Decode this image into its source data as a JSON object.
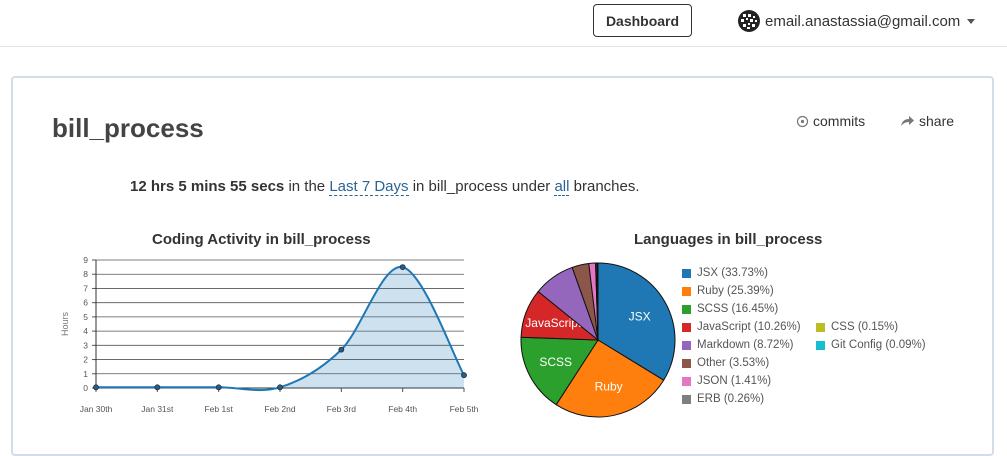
{
  "header": {
    "dashboard_label": "Dashboard",
    "user_email": "email.anastassia@gmail.com"
  },
  "project": {
    "title": "bill_process",
    "commits_label": "commits",
    "share_label": "share"
  },
  "summary": {
    "duration": "12 hrs 5 mins 55 secs",
    "text_in_the": " in the ",
    "range_link": "Last 7 Days",
    "text_in": " in bill_process under ",
    "branches_link": "all",
    "text_branches": " branches."
  },
  "chart_data": [
    {
      "type": "area",
      "title": "Coding Activity in bill_process",
      "ylabel": "Hours",
      "xlabel": "",
      "categories": [
        "Jan 30th",
        "Jan 31st",
        "Feb 1st",
        "Feb 2nd",
        "Feb 3rd",
        "Feb 4th",
        "Feb 5th"
      ],
      "yticks": [
        "0",
        "1",
        "2",
        "3",
        "4",
        "5",
        "6",
        "7",
        "8",
        "9"
      ],
      "ylim": [
        0,
        9
      ],
      "series": [
        {
          "values": [
            0.05,
            0.05,
            0.05,
            0.05,
            2.7,
            8.5,
            0.9
          ],
          "color": "#1f77b4"
        }
      ],
      "grid": true
    },
    {
      "type": "pie",
      "title": "Languages in bill_process",
      "labels": [
        "JSX",
        "Ruby",
        "SCSS",
        "JavaScript",
        "Markdown",
        "Other",
        "JSON",
        "ERB",
        "CSS",
        "Git Config"
      ],
      "values": [
        33.73,
        25.39,
        16.45,
        10.26,
        8.72,
        3.53,
        1.41,
        0.26,
        0.15,
        0.09
      ],
      "legend": [
        "JSX (33.73%)",
        "Ruby (25.39%)",
        "SCSS (16.45%)",
        "JavaScript (10.26%)",
        "Markdown (8.72%)",
        "Other (3.53%)",
        "JSON (1.41%)",
        "ERB (0.26%)",
        "CSS (0.15%)",
        "Git Config (0.09%)"
      ],
      "colors": [
        "#1f77b4",
        "#ff7f0e",
        "#2ca02c",
        "#d62728",
        "#9467bd",
        "#8c564b",
        "#e377c2",
        "#7f7f7f",
        "#bcbd22",
        "#17becf"
      ],
      "slice_labels": [
        "JSX",
        "Ruby",
        "SCSS",
        "JavaScript",
        "",
        "",
        "",
        "",
        "",
        ""
      ]
    }
  ]
}
